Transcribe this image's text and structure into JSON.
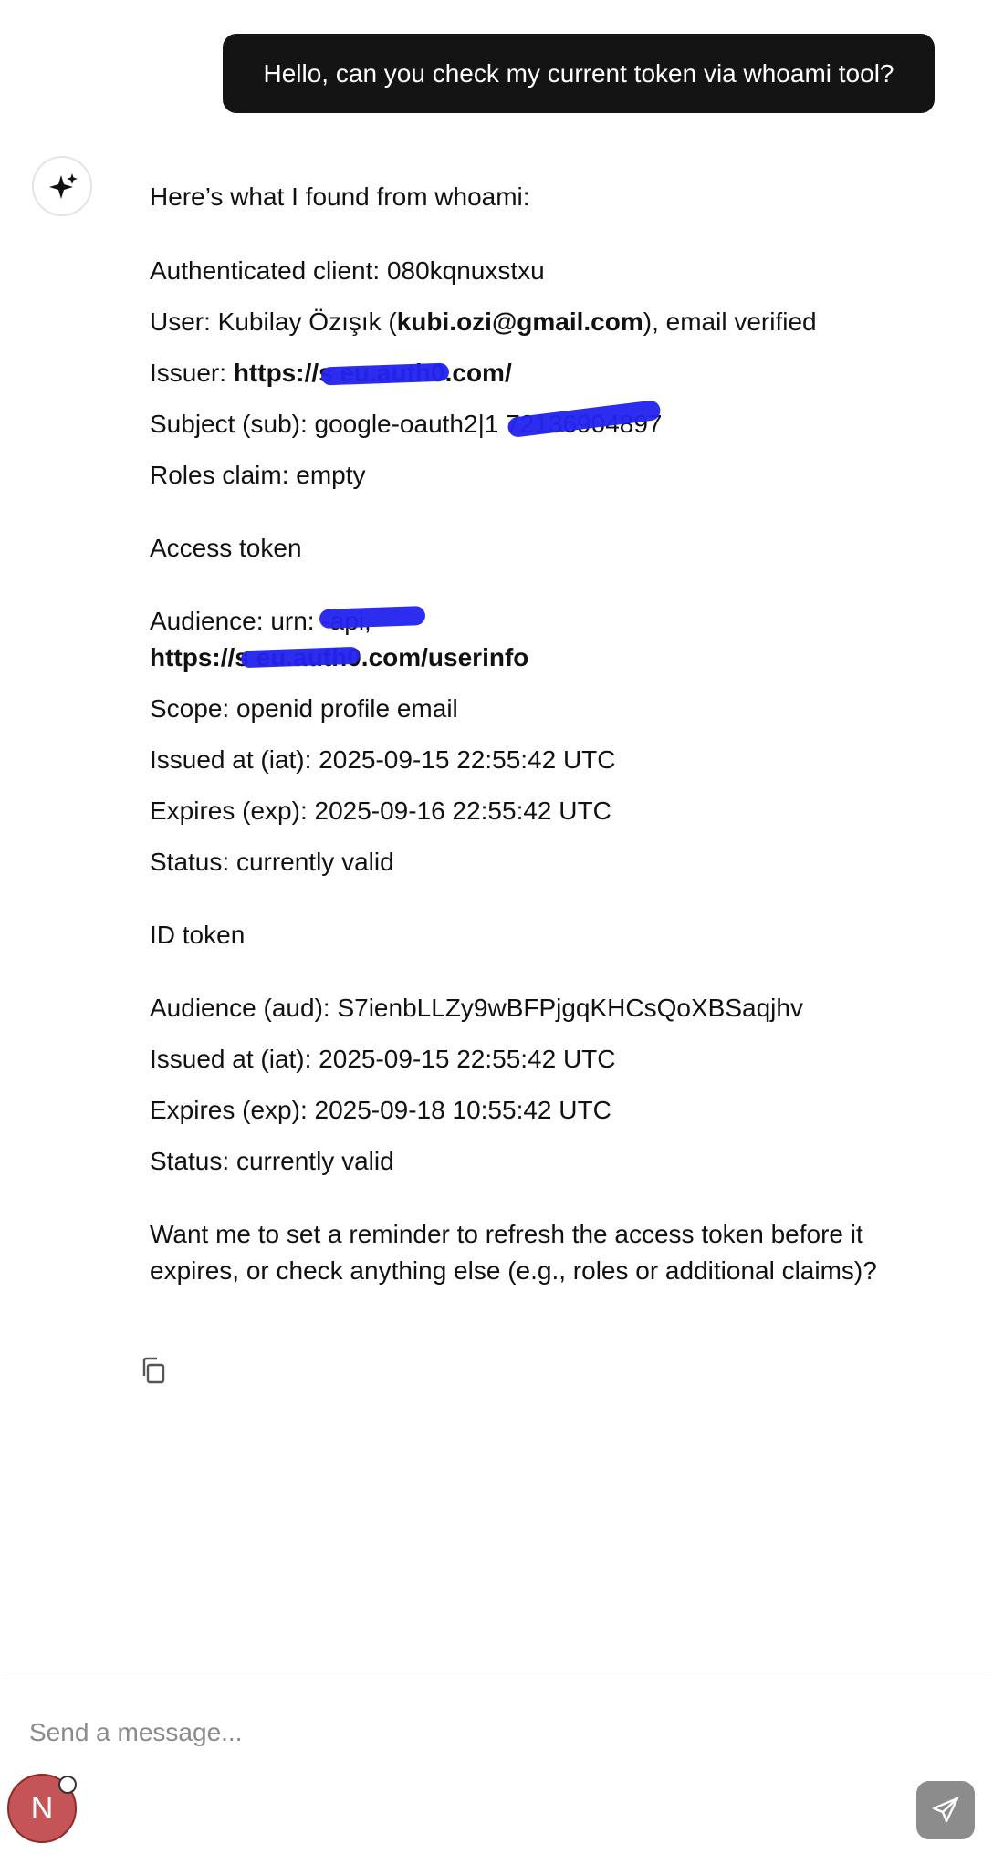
{
  "user_message": "Hello, can you check my current token via whoami tool?",
  "assistant": {
    "intro": "Here’s what I found from whoami:",
    "authenticated_client": "Authenticated client: 080kqnuxstxu",
    "user_prefix": "User: Kubilay Özışık (",
    "user_email": "kubi.ozi@gmail.com",
    "user_suffix": "), email verified",
    "issuer_label": "Issuer: ",
    "issuer_value": "https://s            eu.auth0.com/",
    "subject": "Subject (sub): google-oauth2|1               72136904897",
    "roles": "Roles claim: empty",
    "access_token_heading": "Access token",
    "access_audience_line1": "Audience: urn:              -api,",
    "access_audience_line2": "https://s            eu.auth0.com/userinfo",
    "access_scope": "Scope: openid profile email",
    "access_iat": "Issued at (iat): 2025-09-15 22:55:42 UTC",
    "access_exp": "Expires (exp): 2025-09-16 22:55:42 UTC",
    "access_status": "Status: currently valid",
    "id_token_heading": "ID token",
    "id_audience": "Audience (aud): S7ienbLLZy9wBFPjgqKHCsQoXBSaqjhv",
    "id_iat": "Issued at (iat): 2025-09-15 22:55:42 UTC",
    "id_exp": "Expires (exp): 2025-09-18 10:55:42 UTC",
    "id_status": "Status: currently valid",
    "closing": "Want me to set a reminder to refresh the access token before it expires, or check anything else (e.g., roles or additional claims)?"
  },
  "composer": {
    "placeholder": "Send a message..."
  },
  "user_avatar_initial": "N",
  "colors": {
    "bubble": "#141414",
    "redaction": "#2424ee",
    "avatar": "#c45455",
    "send_button": "#8c8c8c"
  }
}
